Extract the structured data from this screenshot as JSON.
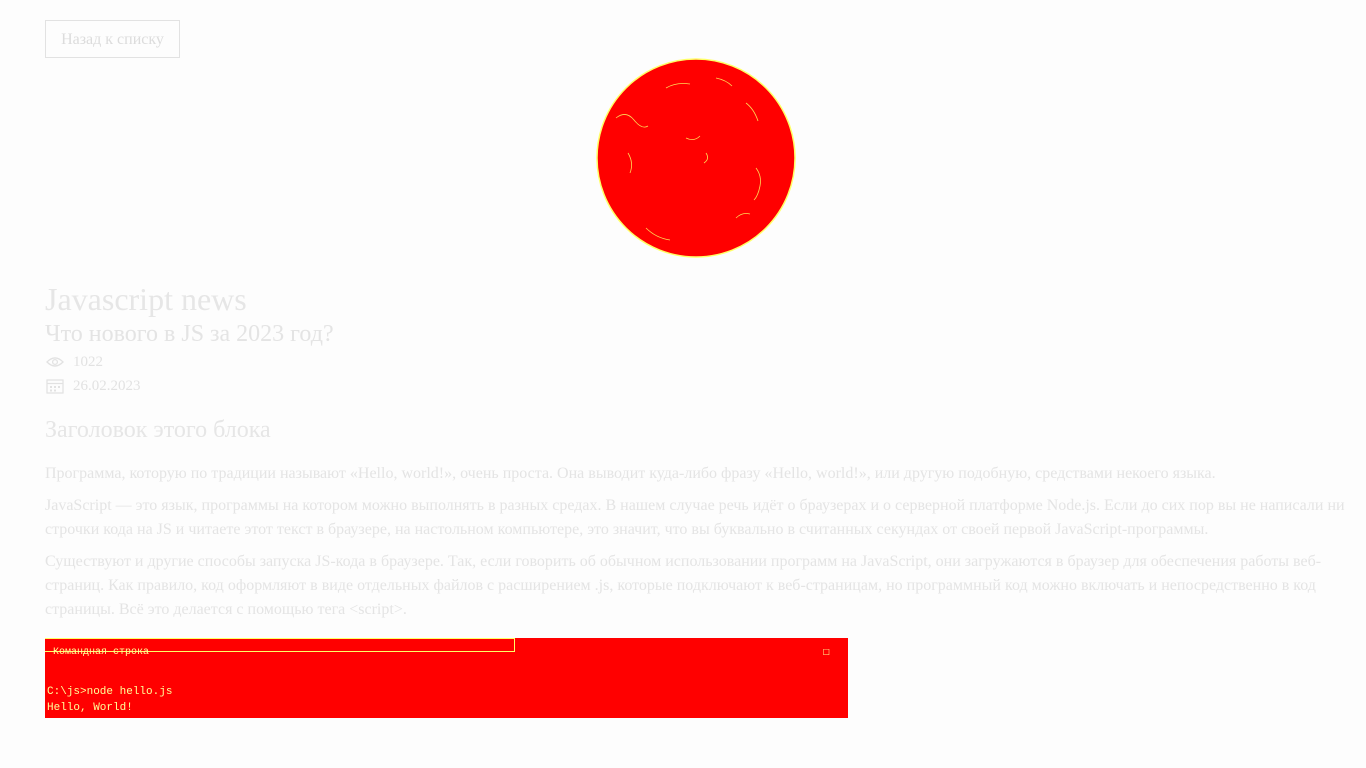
{
  "nav": {
    "back_label": "Назад к списку"
  },
  "hero_image": {
    "icon": "red-circle-image",
    "color": "#ff0000",
    "outline_color": "#ffff66"
  },
  "article": {
    "title": "Javascript news",
    "subtitle": "Что нового в JS за 2023 год?",
    "views": "1022",
    "date": "26.02.2023",
    "block_heading": "Заголовок этого блока",
    "paragraphs": [
      "Программа, которую по традиции называют «Hello, world!», очень проста. Она выводит куда-либо фразу «Hello, world!», или другую подобную, средствами некоего языка.",
      "JavaScript — это язык, программы на котором можно выполнять в разных средах. В нашем случае речь идёт о браузерах и о серверной платформе Node.js. Если до сих пор вы не написали ни строчки кода на JS и читаете этот текст в браузере, на настольном компьютере, это значит, что вы буквально в считанных секундах от своей первой JavaScript-программы.",
      "Существуют и другие способы запуска JS-кода в браузере. Так, если говорить об обычном использовании программ на JavaScript, они загружаются в браузер для обеспечения работы веб-страниц. Как правило, код оформляют в виде отдельных файлов с расширением .js, которые подключают к веб-страницам, но программный код можно включать и непосредственно в код страницы. Всё это делается с помощью тега <script>."
    ]
  },
  "console_image": {
    "color": "#ff0000",
    "title": "Командная строка",
    "command": "C:\\js>node hello.js",
    "output": "Hello, World!"
  }
}
